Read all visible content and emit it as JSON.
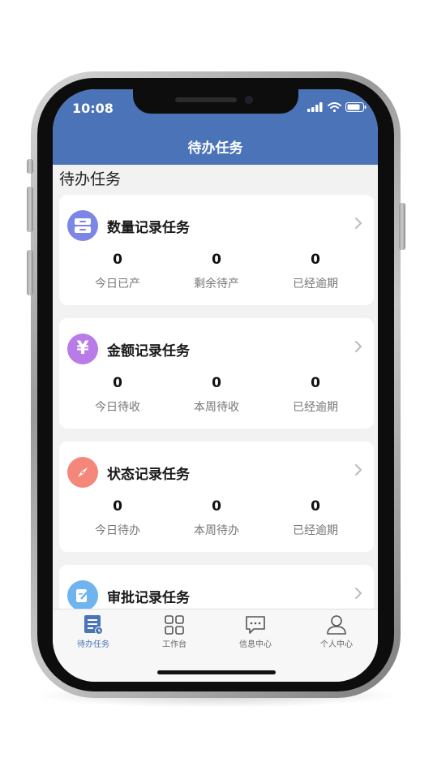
{
  "status_bar": {
    "time": "10:08"
  },
  "header": {
    "title": "待办任务"
  },
  "section": {
    "title": "待办任务"
  },
  "cards": [
    {
      "title": "数量记录任务",
      "icon": "database-icon",
      "icon_color": "#7b86e6",
      "stats": [
        {
          "value": "0",
          "label": "今日已产"
        },
        {
          "value": "0",
          "label": "剩余待产"
        },
        {
          "value": "0",
          "label": "已经逾期"
        }
      ]
    },
    {
      "title": "金额记录任务",
      "icon": "yen-icon",
      "icon_color": "#b87be8",
      "stats": [
        {
          "value": "0",
          "label": "今日待收"
        },
        {
          "value": "0",
          "label": "本周待收"
        },
        {
          "value": "0",
          "label": "已经逾期"
        }
      ]
    },
    {
      "title": "状态记录任务",
      "icon": "compass-icon",
      "icon_color": "#f4877a",
      "stats": [
        {
          "value": "0",
          "label": "今日待办"
        },
        {
          "value": "0",
          "label": "本周待办"
        },
        {
          "value": "0",
          "label": "已经逾期"
        }
      ]
    },
    {
      "title": "审批记录任务",
      "icon": "approval-icon",
      "icon_color": "#6fb3ef"
    }
  ],
  "tabbar": [
    {
      "label": "待办任务",
      "icon": "task-list-icon",
      "active": true
    },
    {
      "label": "工作台",
      "icon": "grid-icon",
      "active": false
    },
    {
      "label": "信息中心",
      "icon": "message-icon",
      "active": false
    },
    {
      "label": "个人中心",
      "icon": "user-icon",
      "active": false
    }
  ],
  "colors": {
    "header": "#4b73b8",
    "background": "#f2f2f2",
    "active_tab": "#4b73b8"
  }
}
